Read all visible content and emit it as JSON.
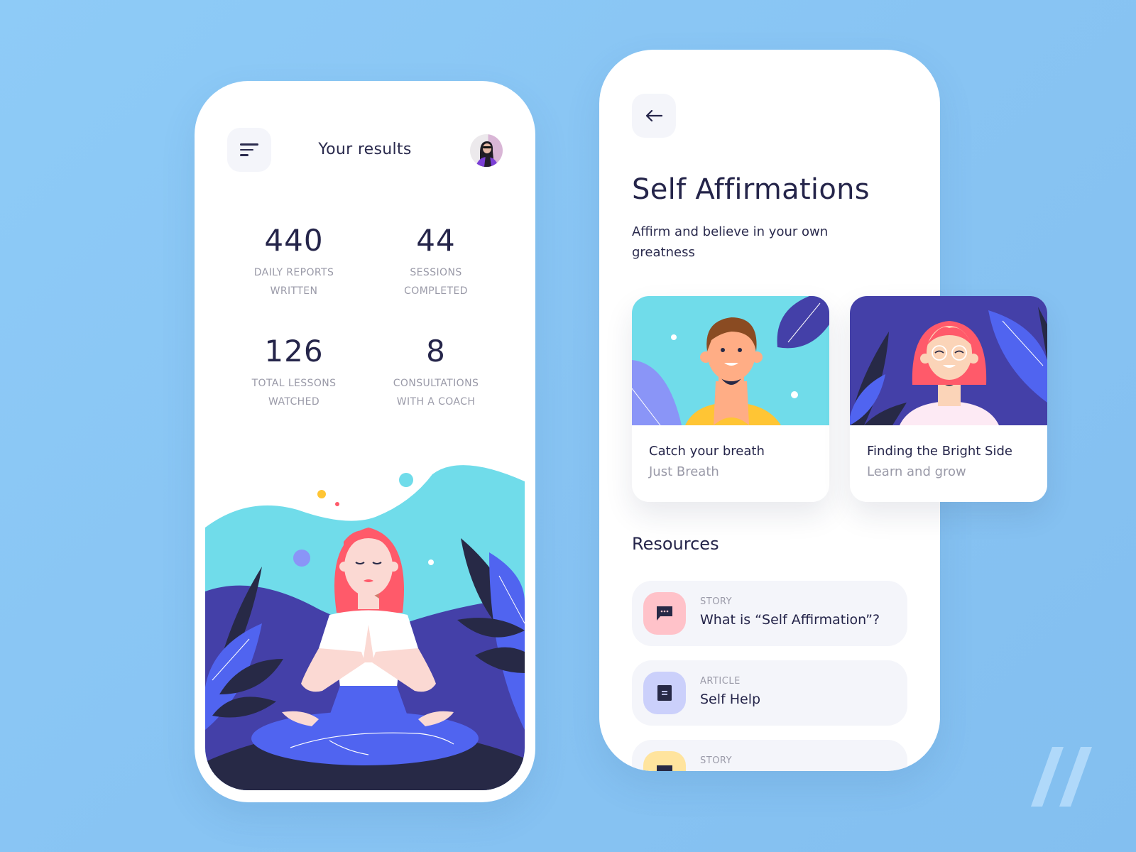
{
  "results_screen": {
    "title": "Your results",
    "menu_icon": "hamburger-menu-icon",
    "avatar": "user-avatar-photo",
    "stats": [
      {
        "value": "440",
        "label_line1": "DAILY REPORTS",
        "label_line2": "WRITTEN"
      },
      {
        "value": "44",
        "label_line1": "SESSIONS",
        "label_line2": "COMPLETED"
      },
      {
        "value": "126",
        "label_line1": "TOTAL LESSONS",
        "label_line2": "WATCHED"
      },
      {
        "value": "8",
        "label_line1": "CONSULTATIONS",
        "label_line2": "WITH A COACH"
      }
    ],
    "illustration": "meditating-woman-illustration"
  },
  "affirmations_screen": {
    "back_icon": "arrow-left-icon",
    "title": "Self Affirmations",
    "subtitle": "Affirm and believe in your own greatness",
    "cards": [
      {
        "title": "Catch your breath",
        "subtitle": "Just Breath",
        "illustration": "smiling-man-illustration"
      },
      {
        "title": "Finding the Bright Side",
        "subtitle": "Learn and grow",
        "illustration": "woman-with-glasses-illustration"
      }
    ],
    "resources_heading": "Resources",
    "resources": [
      {
        "type": "STORY",
        "title": "What is “Self Affirmation”?",
        "icon": "chat-bubble-icon",
        "icon_bg": "#ffc2c9"
      },
      {
        "type": "ARTICLE",
        "title": "Self Help",
        "icon": "document-icon",
        "icon_bg": "#cbd0fb"
      },
      {
        "type": "STORY",
        "title": "",
        "icon": "chat-bubble-icon",
        "icon_bg": "#ffe49e"
      }
    ]
  },
  "colors": {
    "background": "#8ecbf7",
    "text_dark": "#25254a",
    "text_muted": "#9a9aa8",
    "button_bg": "#f4f5fa",
    "cyan": "#70dcea",
    "indigo": "#4440a8",
    "blue": "#5064f0",
    "navy": "#272946",
    "coral": "#ff5a6a"
  }
}
